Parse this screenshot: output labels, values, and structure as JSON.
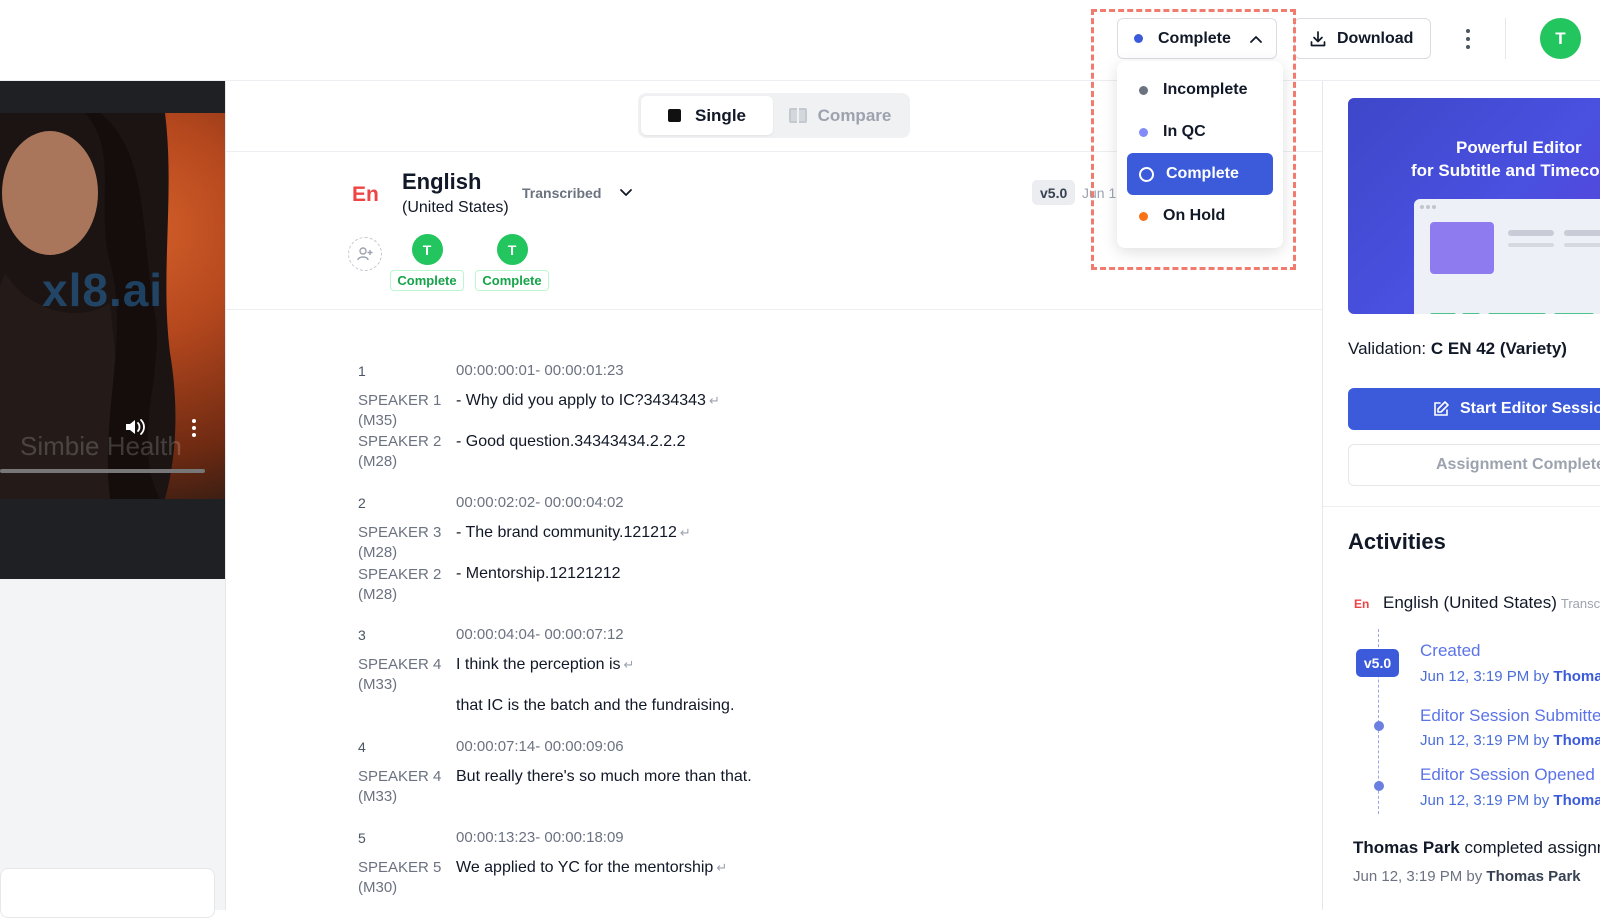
{
  "topbar": {
    "status_label": "Complete",
    "download_label": "Download",
    "avatar_initial": "T"
  },
  "status_menu": {
    "items": [
      {
        "label": "Incomplete",
        "color": "#6b7280"
      },
      {
        "label": "In QC",
        "color": "#818cf8"
      },
      {
        "label": "Complete",
        "color": "#ffffff",
        "selected": true
      },
      {
        "label": "On Hold",
        "color": "#f97316"
      }
    ]
  },
  "video": {
    "watermark": "xl8.ai",
    "overlay_text": "Simbie Health"
  },
  "view_toggle": {
    "single_label": "Single",
    "compare_label": "Compare"
  },
  "language": {
    "code": "En",
    "name": "English",
    "region": "(United States)",
    "status": "Transcribed",
    "version": "v5.0",
    "date": "Jun 1"
  },
  "assignees": [
    {
      "initial": "T",
      "status": "Complete"
    },
    {
      "initial": "T",
      "status": "Complete"
    }
  ],
  "cues": [
    {
      "num": "1",
      "time": "00:00:00:01- 00:00:01:23",
      "lines": [
        {
          "speaker": "SPEAKER 1",
          "variety": "(M35)",
          "text": "- Why did you apply to IC?3434343",
          "ret": true
        },
        {
          "speaker": "SPEAKER 2",
          "variety": "(M28)",
          "text": "- Good question.34343434.2.2.2",
          "ret": false
        }
      ]
    },
    {
      "num": "2",
      "time": "00:00:02:02- 00:00:04:02",
      "lines": [
        {
          "speaker": "SPEAKER 3",
          "variety": "(M28)",
          "text": "- The brand community.121212",
          "ret": true
        },
        {
          "speaker": "SPEAKER 2",
          "variety": "(M28)",
          "text": "- Mentorship.12121212",
          "ret": false
        }
      ]
    },
    {
      "num": "3",
      "time": "00:00:04:04- 00:00:07:12",
      "lines": [
        {
          "speaker": "SPEAKER 4",
          "variety": "(M33)",
          "text": "I think the perception is",
          "ret": true
        },
        {
          "speaker": "",
          "variety": "",
          "text": "that IC is the batch and the fundraising.",
          "ret": false
        }
      ]
    },
    {
      "num": "4",
      "time": "00:00:07:14- 00:00:09:06",
      "lines": [
        {
          "speaker": "SPEAKER 4",
          "variety": "(M33)",
          "text": "But really there's so much more than that.",
          "ret": false
        }
      ]
    },
    {
      "num": "5",
      "time": "00:00:13:23- 00:00:18:09",
      "lines": [
        {
          "speaker": "SPEAKER 5",
          "variety": "(M30)",
          "text": "We applied to YC for the mentorship",
          "ret": true
        }
      ]
    }
  ],
  "sidebar": {
    "promo_line1": "Powerful Editor",
    "promo_line2": "for Subtitle and Timecode",
    "validation_label": "Validation:",
    "validation_value": "C EN 42 (Variety)",
    "editor_button": "Start Editor Session",
    "assignment_button": "Assignment Complete",
    "activities_title": "Activities",
    "activity_lang_code": "En",
    "activity_lang": "English (United States)",
    "activity_lang_status": "Transcribed",
    "version_pill": "v5.0",
    "events": [
      {
        "title": "Created",
        "date": "Jun 12, 3:19 PM",
        "by": "by",
        "user": "Thomas Park"
      },
      {
        "title": "Editor Session Submitted",
        "date": "Jun 12, 3:19 PM",
        "by": "by",
        "user": "Thomas Park"
      },
      {
        "title": "Editor Session Opened",
        "date": "Jun 12, 3:19 PM",
        "by": "by",
        "user": "Thomas Park"
      }
    ],
    "summary_user": "Thomas Park",
    "summary_text": "completed assignment",
    "summary_date": "Jun 12, 3:19 PM",
    "summary_by": "by",
    "summary_by_user": "Thomas Park"
  }
}
